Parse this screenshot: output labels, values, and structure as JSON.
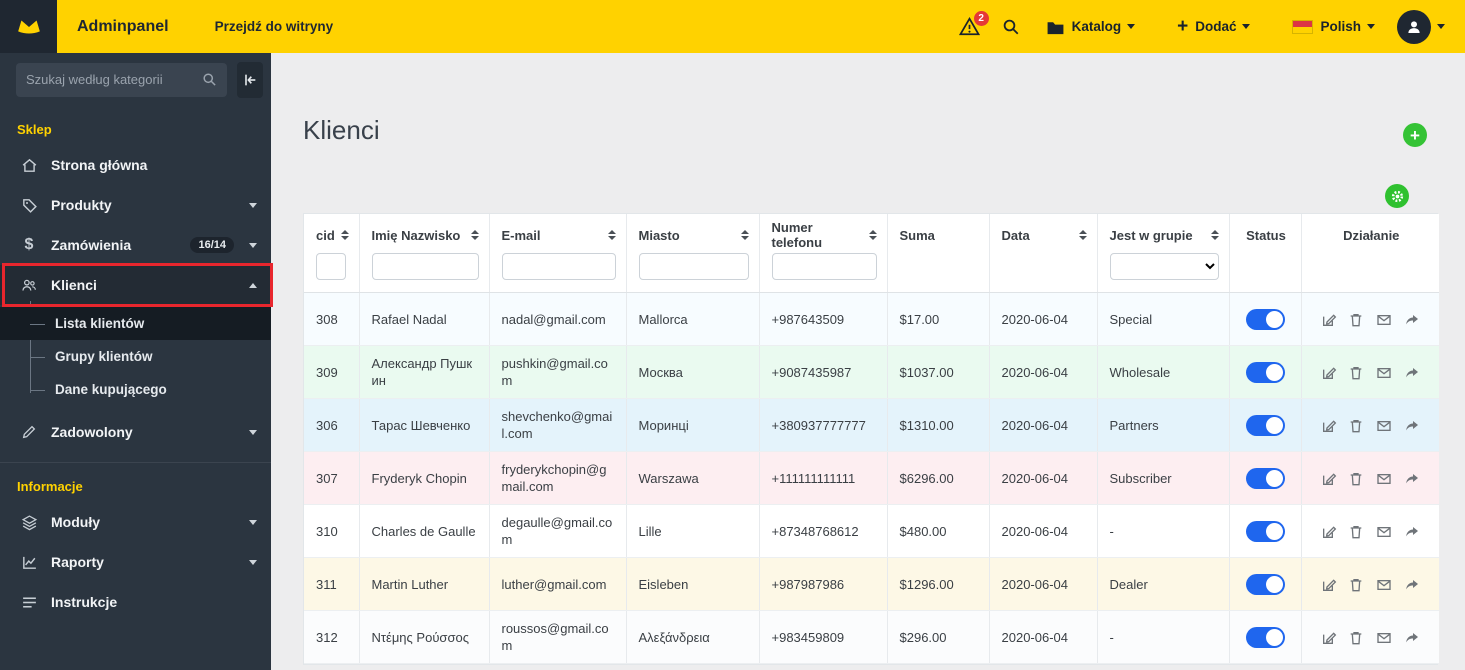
{
  "topbar": {
    "brand": "Adminpanel",
    "goto_site": "Przejdź do witryny",
    "alerts_badge": "2",
    "catalog_label": "Katalog",
    "add_label": "Dodać",
    "language_label": "Polish"
  },
  "icons": {
    "plus_glyph": "+",
    "dollar_glyph": "$"
  },
  "colors": {
    "topbar": "#ffd200",
    "sidebar": "#2b3540",
    "toggle_on": "#1f66ee",
    "add_button_green": "#35c335",
    "highlight_frame_red": "#e8262d"
  },
  "sidebar": {
    "search_placeholder": "Szukaj według kategorii",
    "section_shop": "Sklep",
    "section_info": "Informacje",
    "items": [
      {
        "label": "Strona główna"
      },
      {
        "label": "Produkty"
      },
      {
        "label": "Zamówienia",
        "badge": "16/14"
      },
      {
        "label": "Klienci"
      },
      {
        "label": "Zadowolony"
      },
      {
        "label": "Moduły"
      },
      {
        "label": "Raporty"
      },
      {
        "label": "Instrukcje"
      }
    ],
    "submenu": [
      {
        "label": "Lista klientów",
        "active": true
      },
      {
        "label": "Grupy klientów"
      },
      {
        "label": "Dane kupującego"
      }
    ]
  },
  "content": {
    "title": "Klienci"
  },
  "table": {
    "columns": [
      {
        "label": "cid"
      },
      {
        "label": "Imię Nazwisko"
      },
      {
        "label": "E-mail"
      },
      {
        "label": "Miasto"
      },
      {
        "label": "Numer telefonu"
      },
      {
        "label": "Suma"
      },
      {
        "label": "Data"
      },
      {
        "label": "Jest w grupie"
      },
      {
        "label": "Status"
      },
      {
        "label": "Działanie"
      }
    ],
    "rows": [
      {
        "cid": "308",
        "name": "Rafael Nadal",
        "email": "nadal@gmail.com",
        "city": "Mallorca",
        "phone": "+987643509",
        "suma": "$17.00",
        "date": "2020-06-04",
        "group": "Special",
        "status": "on",
        "tint": "#f7fcff"
      },
      {
        "cid": "309",
        "name": "Александр Пушкин",
        "email": "pushkin@gmail.com",
        "city": "Москва",
        "phone": "+9087435987",
        "suma": "$1037.00",
        "date": "2020-06-04",
        "group": "Wholesale",
        "status": "on",
        "tint": "#eafaf0"
      },
      {
        "cid": "306",
        "name": "Тарас Шевченко",
        "email": "shevchenko@gmail.com",
        "city": "Моринці",
        "phone": "+380937777777",
        "suma": "$1310.00",
        "date": "2020-06-04",
        "group": "Partners",
        "status": "on",
        "tint": "#e4f3fb"
      },
      {
        "cid": "307",
        "name": "Fryderyk Chopin",
        "email": "fryderykchopin@gmail.com",
        "city": "Warszawa",
        "phone": "+111111111111",
        "suma": "$6296.00",
        "date": "2020-06-04",
        "group": "Subscriber",
        "status": "on",
        "tint": "#fdeef1"
      },
      {
        "cid": "310",
        "name": "Charles de Gaulle",
        "email": "degaulle@gmail.com",
        "city": "Lille",
        "phone": "+87348768612",
        "suma": "$480.00",
        "date": "2020-06-04",
        "group": "-",
        "status": "on",
        "tint": "#ffffff"
      },
      {
        "cid": "311",
        "name": "Martin Luther",
        "email": "luther@gmail.com",
        "city": "Eisleben",
        "phone": "+987987986",
        "suma": "$1296.00",
        "date": "2020-06-04",
        "group": "Dealer",
        "status": "on",
        "tint": "#fdf8e6"
      },
      {
        "cid": "312",
        "name": "Ντέμης Ρούσσος",
        "email": "roussos@gmail.com",
        "city": "Αλεξάνδρεια",
        "phone": "+983459809",
        "suma": "$296.00",
        "date": "2020-06-04",
        "group": "-",
        "status": "on",
        "tint": "#fbfcfd"
      }
    ]
  }
}
